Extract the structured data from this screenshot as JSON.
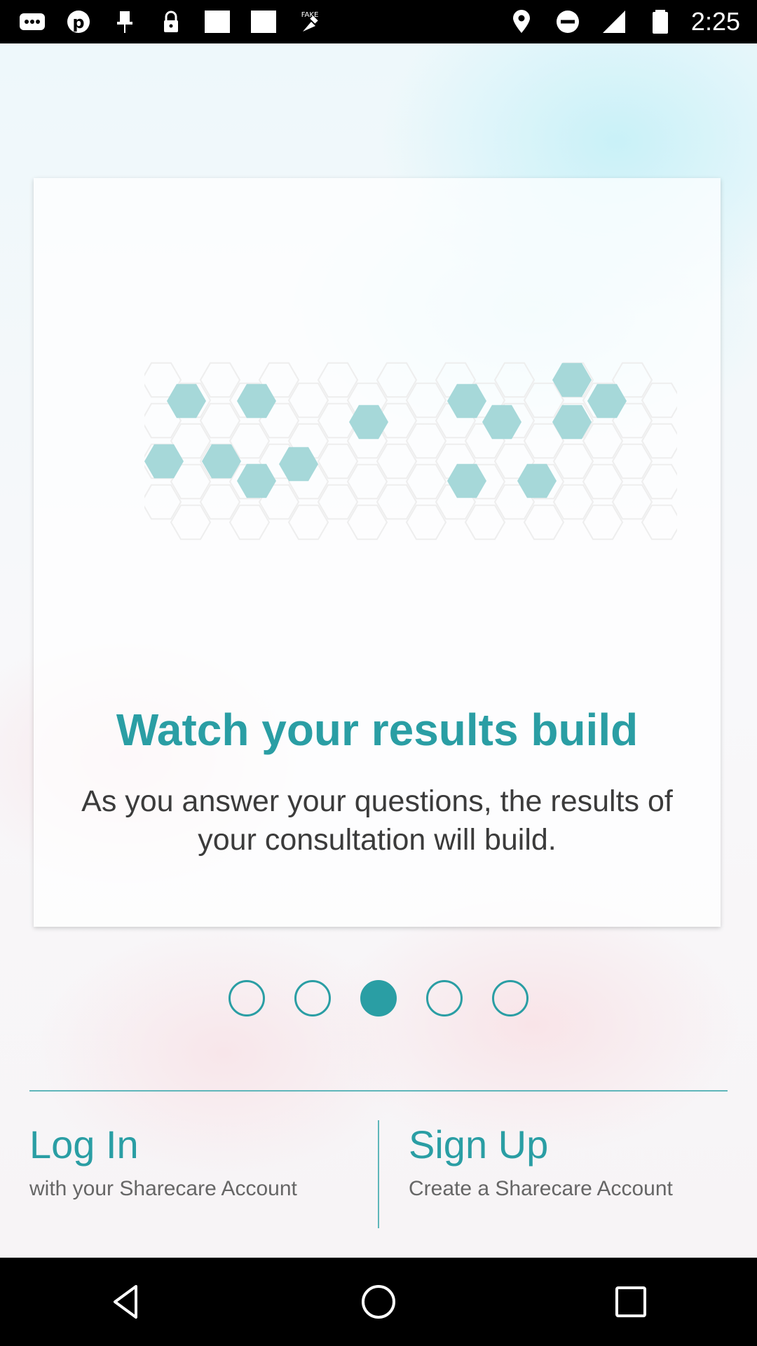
{
  "status_bar": {
    "time": "2:25",
    "left_icons": [
      "messages-icon",
      "pinterest-icon",
      "pushpin-icon",
      "lock-icon",
      "blank-square-icon",
      "blank-square-icon",
      "fake-gps-icon"
    ],
    "right_icons": [
      "location-icon",
      "do-not-disturb-icon",
      "signal-icon",
      "battery-icon"
    ]
  },
  "card": {
    "title": "Watch your results build",
    "description": "As you answer your questions, the results of your consultation will build."
  },
  "pager": {
    "total": 5,
    "active_index": 2
  },
  "auth": {
    "login": {
      "title": "Log In",
      "subtitle": "with your Sharecare Account"
    },
    "signup": {
      "title": "Sign Up",
      "subtitle": "Create a Sharecare Account"
    }
  },
  "nav_bar": {
    "buttons": [
      "back-icon",
      "home-icon",
      "recents-icon"
    ]
  },
  "colors": {
    "accent": "#2a9ea4",
    "hex_fill": "#a6d8d9",
    "hex_outline": "#eeeeee"
  }
}
